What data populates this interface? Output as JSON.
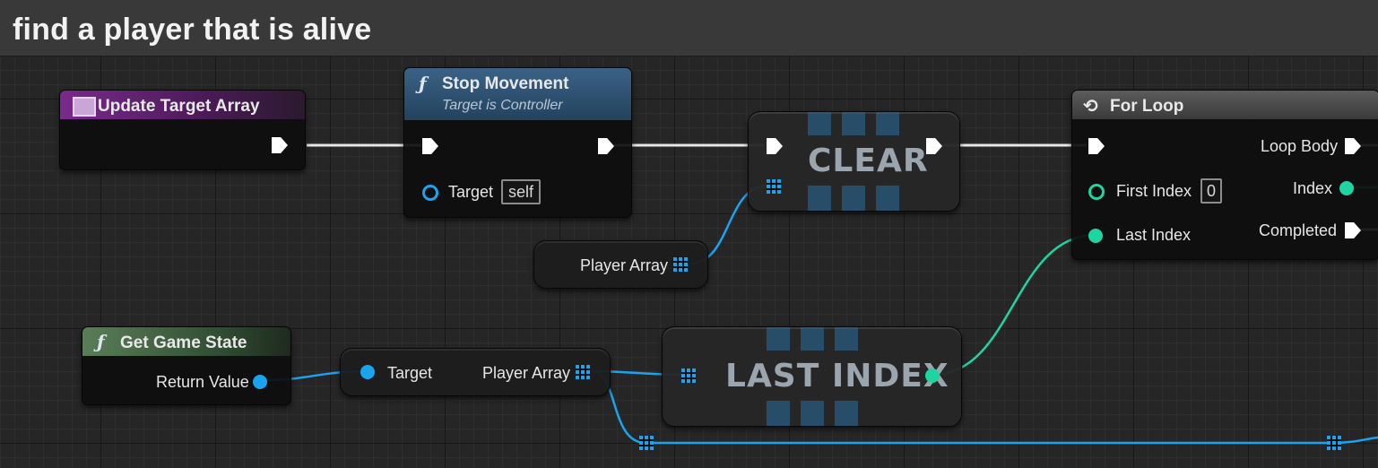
{
  "comment": {
    "title": "find a player that is alive"
  },
  "nodes": {
    "update_target_array": {
      "title": "Update Target Array"
    },
    "stop_movement": {
      "title": "Stop Movement",
      "subtitle": "Target is Controller",
      "target_label": "Target",
      "target_value": "self"
    },
    "clear": {
      "title": "CLEAR"
    },
    "player_array_getter": {
      "label": "Player Array"
    },
    "for_loop": {
      "title": "For Loop",
      "first_index_label": "First Index",
      "first_index_value": "0",
      "last_index_label": "Last Index",
      "loop_body_label": "Loop Body",
      "index_label": "Index",
      "completed_label": "Completed"
    },
    "get_game_state": {
      "title": "Get Game State",
      "return_label": "Return Value"
    },
    "player_array_member": {
      "target_label": "Target",
      "output_label": "Player Array"
    },
    "last_index": {
      "title": "LAST INDEX"
    }
  },
  "colors": {
    "exec": "#ffffff",
    "object": "#1aa4f0",
    "integer": "#1ed4a0",
    "function_header": "#2f4f6b",
    "event_header": "#6a2a7a",
    "pure_header": "#3b5e3b",
    "macro_header": "#4a4a4a"
  }
}
